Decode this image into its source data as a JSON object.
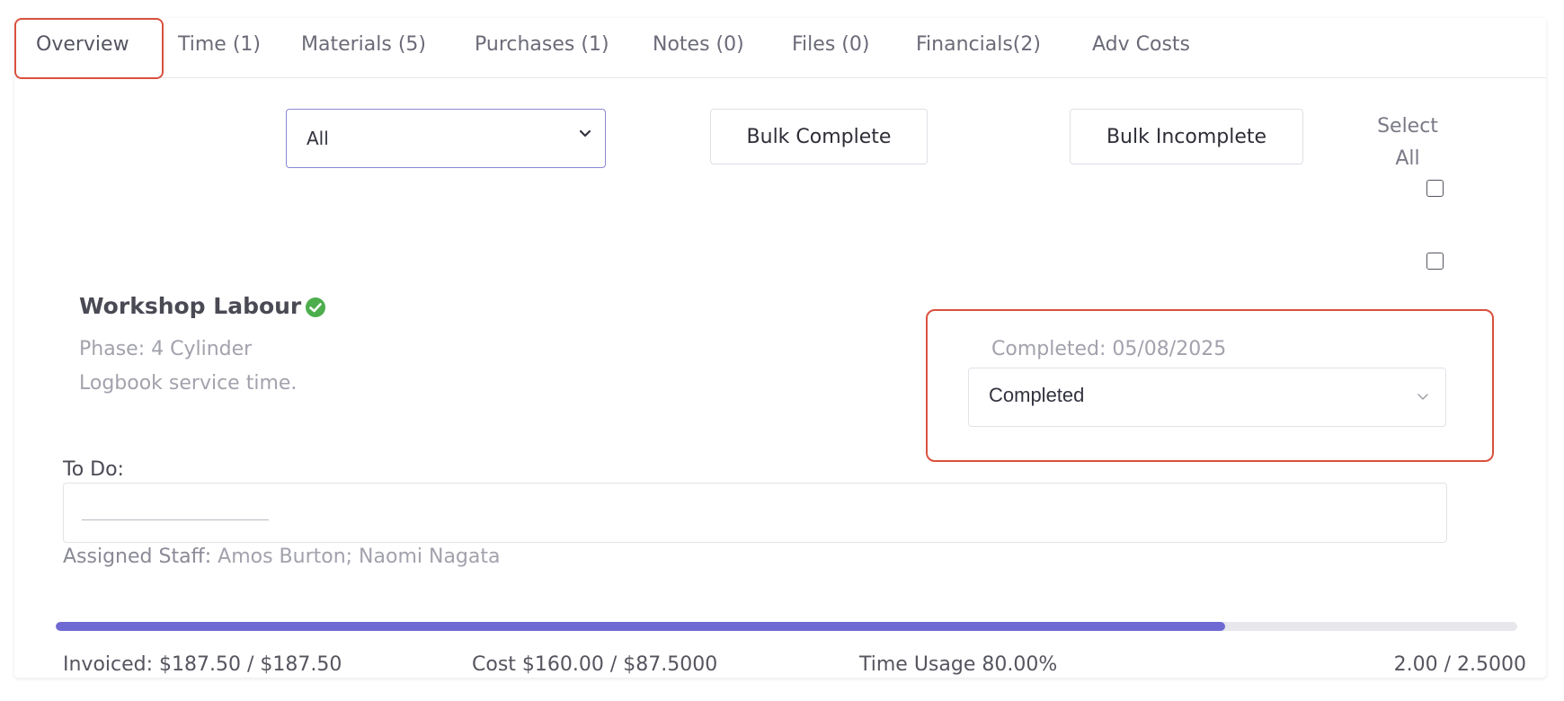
{
  "tabs": [
    {
      "label": "Overview",
      "active": true
    },
    {
      "label": "Time (1)"
    },
    {
      "label": "Materials (5)"
    },
    {
      "label": "Purchases (1)"
    },
    {
      "label": "Notes (0)"
    },
    {
      "label": "Files (0)"
    },
    {
      "label": "Financials(2)"
    },
    {
      "label": "Adv Costs"
    }
  ],
  "toolbar": {
    "filter_value": "All",
    "bulk_complete_label": "Bulk Complete",
    "bulk_incomplete_label": "Bulk Incomplete",
    "select_all_label_line1": "Select",
    "select_all_label_line2": "All"
  },
  "item": {
    "title": "Workshop Labour",
    "phase": "Phase: 4 Cylinder",
    "description": "Logbook service time.",
    "completed_text": "Completed: 05/08/2025",
    "status_value": "Completed",
    "todo_label": "To Do:",
    "assigned_label": "Assigned Staff:",
    "assigned_value": "Amos Burton; Naomi Nagata"
  },
  "footer": {
    "invoiced": "Invoiced: $187.50 / $187.50",
    "cost": "Cost $160.00 / $87.5000",
    "time_usage": "Time Usage 80.00%",
    "hours": "2.00 / 2.5000",
    "progress_fraction": 0.8
  },
  "colors": {
    "accent": "#6f69d3",
    "highlight": "#d9513d",
    "success": "#4cae4c"
  },
  "icons": {
    "status": "check-circle-icon",
    "dropdown": "chevron-down-icon"
  }
}
